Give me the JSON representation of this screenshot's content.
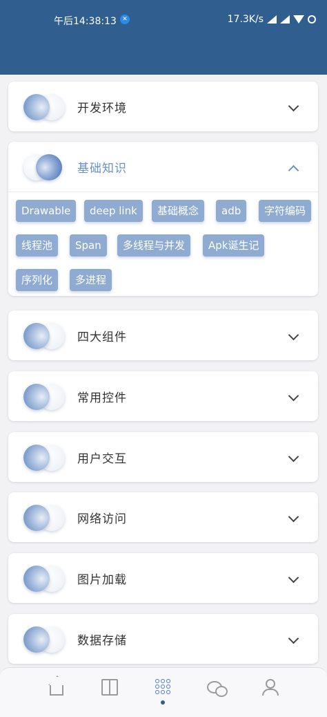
{
  "status_bar": {
    "time": "午后14:38:13",
    "network_speed": "17.3K/s",
    "badge_icon": "app-notification-icon"
  },
  "sections": [
    {
      "title": "开发环境",
      "expanded": false
    },
    {
      "title": "基础知识",
      "expanded": true,
      "tags": [
        "Drawable",
        "deep link",
        "基础概念",
        "adb",
        "字符编码",
        "线程池",
        "Span",
        "多线程与并发",
        "Apk诞生记",
        "序列化",
        "多进程"
      ]
    },
    {
      "title": "四大组件",
      "expanded": false
    },
    {
      "title": "常用控件",
      "expanded": false
    },
    {
      "title": "用户交互",
      "expanded": false
    },
    {
      "title": "网络访问",
      "expanded": false
    },
    {
      "title": "图片加载",
      "expanded": false
    },
    {
      "title": "数据存储",
      "expanded": false
    }
  ],
  "bottom_nav": {
    "items": [
      {
        "icon": "home-icon"
      },
      {
        "icon": "book-icon"
      },
      {
        "icon": "grid-icon",
        "active": true
      },
      {
        "icon": "wechat-icon"
      },
      {
        "icon": "user-icon"
      }
    ],
    "accent_color": "#2f5e8f"
  },
  "colors": {
    "header": "#2f5e8f",
    "tag_background": "#8fabd2",
    "active_title": "#6a92c6"
  }
}
